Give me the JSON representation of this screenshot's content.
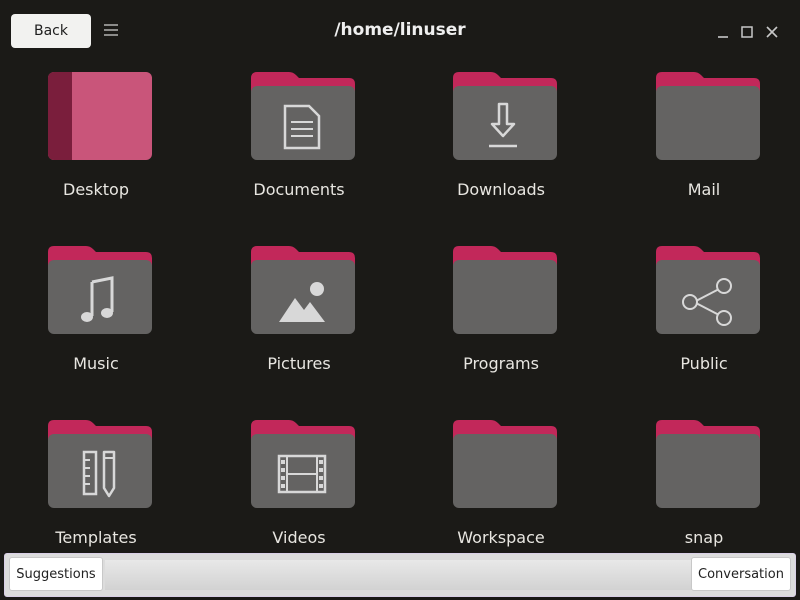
{
  "titlebar": {
    "back_label": "Back",
    "title": "/home/linuser"
  },
  "colors": {
    "background": "#1b1a17",
    "folder_tab": "#c2285a",
    "folder_body": "#646362",
    "desktop_folder": "#c9557a"
  },
  "folders": [
    {
      "name": "Desktop",
      "icon": "desktop-folder-icon"
    },
    {
      "name": "Documents",
      "icon": "document-icon"
    },
    {
      "name": "Downloads",
      "icon": "download-icon"
    },
    {
      "name": "Mail",
      "icon": "folder-icon"
    },
    {
      "name": "Music",
      "icon": "music-note-icon"
    },
    {
      "name": "Pictures",
      "icon": "picture-icon"
    },
    {
      "name": "Programs",
      "icon": "folder-icon"
    },
    {
      "name": "Public",
      "icon": "share-icon"
    },
    {
      "name": "Templates",
      "icon": "ruler-pencil-icon"
    },
    {
      "name": "Videos",
      "icon": "film-icon"
    },
    {
      "name": "Workspace",
      "icon": "folder-icon"
    },
    {
      "name": "snap",
      "icon": "folder-icon"
    }
  ],
  "statusbar": {
    "suggestions_label": "Suggestions",
    "conversation_label": "Conversation"
  }
}
